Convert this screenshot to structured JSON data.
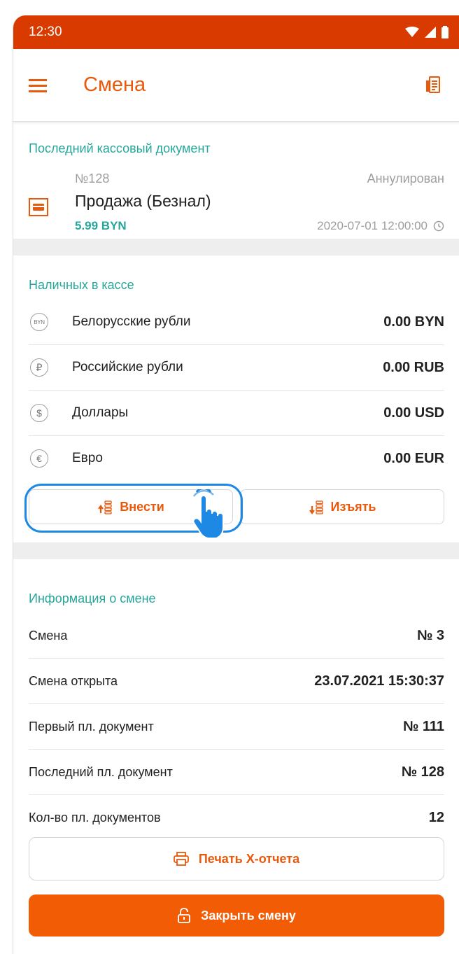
{
  "status_bar": {
    "time": "12:30"
  },
  "app_bar": {
    "title": "Смена",
    "menu_icon": "menu-icon",
    "receipt_icon": "receipt-icon"
  },
  "last_document": {
    "section_title": "Последний кассовый документ",
    "number": "№128",
    "status": "Аннулирован",
    "type": "Продажа (Безнал)",
    "amount": "5.99 BYN",
    "datetime": "2020-07-01 12:00:00"
  },
  "cash": {
    "section_title": "Наличных в кассе",
    "currencies": [
      {
        "icon": "BYN",
        "label": "Белорусские рубли",
        "value": "0.00 BYN"
      },
      {
        "icon": "₽",
        "label": "Российские рубли",
        "value": "0.00 RUB"
      },
      {
        "icon": "$",
        "label": "Доллары",
        "value": "0.00 USD"
      },
      {
        "icon": "€",
        "label": "Евро",
        "value": "0.00 EUR"
      }
    ],
    "deposit_label": "Внести",
    "withdraw_label": "Изъять"
  },
  "shift_info": {
    "section_title": "Информация о смене",
    "rows": [
      {
        "label": "Смена",
        "value": "№ 3"
      },
      {
        "label": "Смена открыта",
        "value": "23.07.2021 15:30:37"
      },
      {
        "label": "Первый пл. документ",
        "value": "№ 111"
      },
      {
        "label": "Последний пл. документ",
        "value": "№ 128"
      },
      {
        "label": "Кол-во пл. документов",
        "value": "12"
      }
    ]
  },
  "actions": {
    "print_label": "Печать X-отчета",
    "close_label": "Закрыть смену"
  },
  "colors": {
    "status_bar": "#d93a00",
    "accent": "#e8590c",
    "teal": "#26a69a",
    "highlight": "#1e88e5",
    "primary_button": "#f25c05"
  }
}
